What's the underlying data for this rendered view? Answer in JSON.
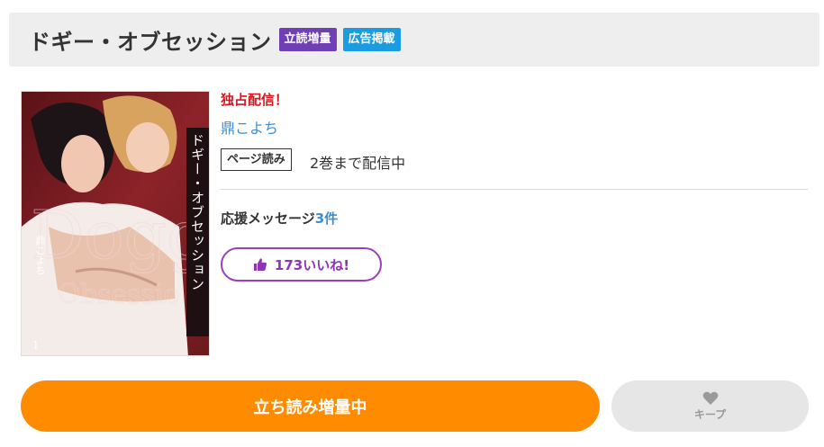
{
  "header": {
    "title": "ドギー・オブセッション",
    "badges": [
      "立読増量",
      "広告掲載"
    ]
  },
  "cover": {
    "vertical_title": "ドギー・オブセッション",
    "author": "鼎こよち",
    "volume": "1"
  },
  "info": {
    "exclusive_label": "独占配信！",
    "author": "鼎こよち",
    "tag_label": "ページ読み",
    "tag_status": "2巻まで配信中",
    "support_prefix": "応援メッセージ",
    "support_count": "3件",
    "like_label": "173いいね!"
  },
  "actions": {
    "read_label": "立ち読み増量中",
    "keep_label": "キープ"
  },
  "colors": {
    "accent_orange": "#ff8b00",
    "badge_purple": "#6f3fb6",
    "badge_blue": "#1b9be0",
    "exclusive_red": "#d9151f",
    "link_blue": "#3a8ed6",
    "like_purple": "#9a3fc2"
  }
}
